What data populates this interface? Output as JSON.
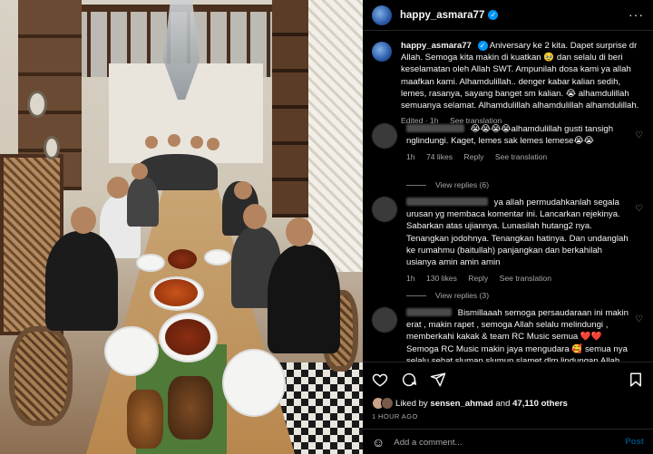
{
  "post": {
    "username": "happy_asmara77",
    "verified_label": "✓",
    "more_label": "···"
  },
  "caption": {
    "username": "happy_asmara77",
    "text": "Aniversary ke 2 kita. Dapet surprise dr Allah. Semoga kita makin di kuatkan 🥹 dan selalu di beri keselamatan oleh Allah SWT. Ampunilah dosa kami ya allah maafkan kami. Alhamdulillah.. denger kabar kalian sedih, lemes, rasanya, sayang banget sm kalian. 😭 alhamdulillah semuanya selamat. Alhamdulillah alhamdulillah alhamdulillah.",
    "edited": "Edited · 1h",
    "see_translation": "See translation"
  },
  "comments": [
    {
      "text": "😭😭😭😭alhamdulillah gusti tansigh nglindungi. Kaget, lemes sak lemes lemese😭😭",
      "time": "1h",
      "likes": "74 likes",
      "reply": "Reply",
      "see_translation": "See translation",
      "view_replies": "View replies (6)"
    },
    {
      "text": "ya allah permudahkanlah segala urusan yg membaca komentar ini. Lancarkan rejekinya. Sabarkan atas ujiannya. Lunasilah hutang2 nya. Tenangkan jodohnya. Tenangkan hatinya. Dan undanglah ke rumahmu (baitullah) panjangkan dan berkahilah usianya amin amin amin",
      "time": "1h",
      "likes": "130 likes",
      "reply": "Reply",
      "see_translation": "See translation",
      "view_replies": "View replies (3)"
    },
    {
      "text": "Bismillaaah semoga persaudaraan ini makin erat , makin rapet , semoga Allah selalu melindungi , memberkahi kakak & team RC Music semua ❤️❤️ Semoga RC Music makin jaya mengudara 🥰 semua nya selalu sehat sluman slumun slamet dlm lindungan Allah"
    }
  ],
  "footer": {
    "liked_by_prefix": "Liked by",
    "liked_by_user": "sensen_ahmad",
    "liked_by_and": "and",
    "liked_by_count": "47,110 others",
    "time": "1 HOUR AGO",
    "comment_placeholder": "Add a comment...",
    "post_label": "Post"
  },
  "icons": [
    "heart-icon",
    "comment-icon",
    "share-icon",
    "bookmark-icon",
    "emoji-icon",
    "more-icon",
    "verified-icon"
  ],
  "colors": {
    "accent": "#0095f6",
    "muted": "#a8a8a8",
    "background": "#000000"
  }
}
